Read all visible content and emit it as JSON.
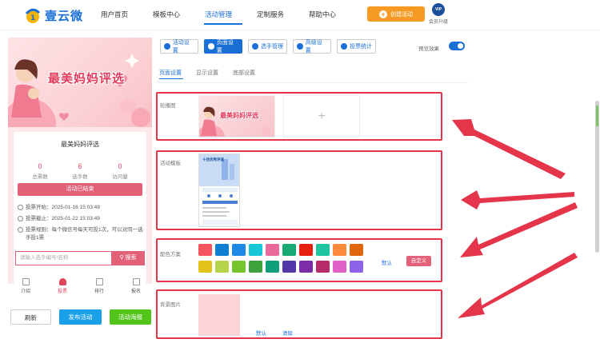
{
  "header": {
    "logo_text": "壹云微",
    "nav": [
      "用户首页",
      "模板中心",
      "活动管理",
      "定制服务",
      "帮助中心"
    ],
    "create_button": "创建活动",
    "vip_badge": "VIP",
    "vip_label": "会员升级"
  },
  "preview": {
    "banner_title": "最美妈妈评选",
    "activity_title": "最美妈妈评选",
    "stats": [
      {
        "value": "0",
        "label": "总票数"
      },
      {
        "value": "6",
        "label": "选手数"
      },
      {
        "value": "0",
        "label": "访问量"
      }
    ],
    "ended_label": "活动已结束",
    "vote_start": "投票开始：2025-01-16 15:03:49",
    "vote_end": "投票截止：2025-01-22 15:03:49",
    "vote_rule": "投票规则：每个微信号每天可投1次，可以对同一选手投1票",
    "search_placeholder": "请输入选手编号/名称",
    "search_button": "搜索",
    "bottom_nav": [
      "介绍",
      "投票",
      "排行",
      "报名"
    ],
    "actions": {
      "refresh": "刷新",
      "publish": "发布活动",
      "poster": "活动海报"
    }
  },
  "panel": {
    "tools": [
      "活动设置",
      "页面设置",
      "选手管理",
      "高级设置",
      "投票统计"
    ],
    "preview_effect": "预览效果",
    "subtabs": [
      "页面设置",
      "显示设置",
      "底部设置"
    ],
    "sections": {
      "carousel": "轮播图",
      "template": "活动模板",
      "scheme": "配色方案",
      "background": "背景图片"
    },
    "carousel_thumb_title": "最美妈妈评选",
    "add_symbol": "+",
    "template_thumb_title": "十佳优秀评选",
    "scheme_default": "默认",
    "scheme_custom": "自定义",
    "bg_default": "默认",
    "bg_clear": "清除"
  },
  "colors": {
    "accent": "#1a6fd6",
    "brand_pink": "#e36178",
    "highlight_red": "#e5354b",
    "swatches_row1": [
      "#f4555f",
      "#0f7fd3",
      "#1e88e5",
      "#17c7d6",
      "#e8699a",
      "#19a974",
      "#e5200e",
      "#1fc4a0",
      "#ff8a3c",
      "#e0660d"
    ],
    "swatches_row2": [
      "#e4c31a",
      "#b6d44b",
      "#77c52e",
      "#3ea23c",
      "#0f9e7a",
      "#5238a8",
      "#7b2ca6",
      "#b62b6a",
      "#e362c9",
      "#8d62e8"
    ]
  }
}
